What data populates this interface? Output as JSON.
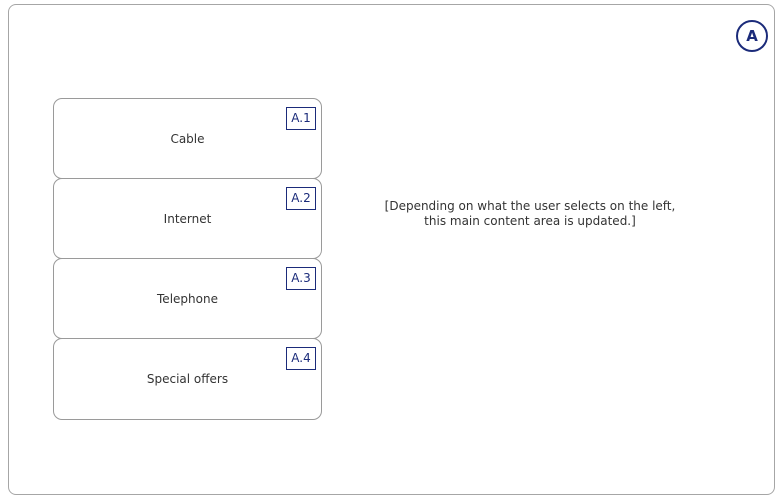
{
  "section_marker": "A",
  "nav": {
    "items": [
      {
        "label": "Cable",
        "tag": "A.1"
      },
      {
        "label": "Internet",
        "tag": "A.2"
      },
      {
        "label": "Telephone",
        "tag": "A.3"
      },
      {
        "label": "Special offers",
        "tag": "A.4"
      }
    ]
  },
  "main": {
    "note_lines": [
      "[Depending on what the user selects on the left,",
      "this main content area is updated.]"
    ]
  },
  "colors": {
    "annotation": "#1b2b7a",
    "border": "#9a9a9a",
    "text": "#333333"
  }
}
